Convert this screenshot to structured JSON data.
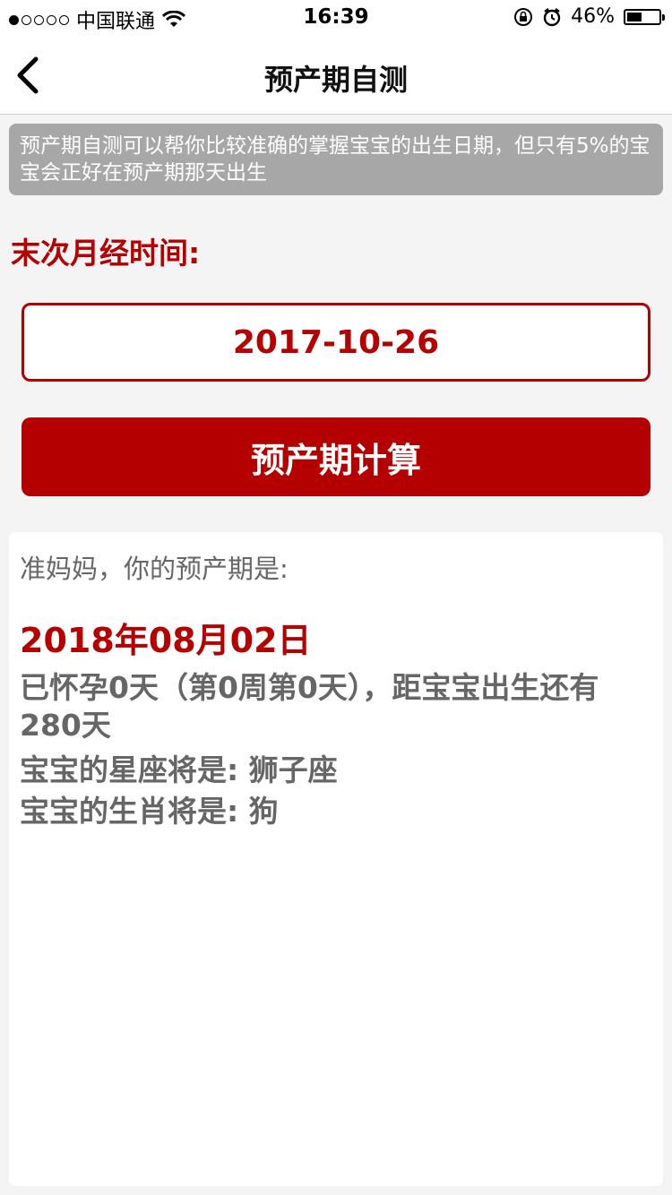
{
  "status_bar": {
    "carrier": "中国联通",
    "time": "16:39",
    "battery": "46%",
    "battery_level": 0.46,
    "signal_bars_filled": 1,
    "signal_bars_total": 5
  },
  "nav": {
    "back_icon": "chevron-left-icon",
    "title": "预产期自测"
  },
  "tip": {
    "text": "预产期自测可以帮你比较准确的掌握宝宝的出生日期，但只有5%的宝宝会正好在预产期那天出生"
  },
  "form": {
    "lmp_label": "末次月经时间:",
    "lmp_value": "2017-10-26",
    "calc_button": "预产期计算"
  },
  "result": {
    "intro": "准妈妈，你的预产期是:",
    "due_date": "2018年08月02日",
    "pregnancy_status": "已怀孕0天（第0周第0天），距宝宝出生还有280天",
    "zodiac": "宝宝的星座将是: 狮子座",
    "chinese_zodiac": "宝宝的生肖将是: 狗"
  },
  "colors": {
    "accent": "#b40000",
    "tip_bg": "#a7a7a7",
    "page_bg": "#f4f4f4"
  }
}
